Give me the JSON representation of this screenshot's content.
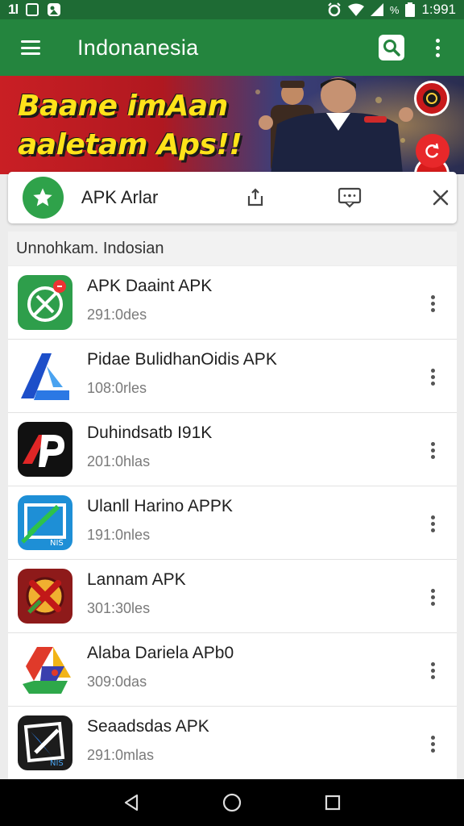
{
  "status_bar": {
    "left_items": [
      "1l"
    ],
    "time": "1:991",
    "battery_text": "%"
  },
  "app_bar": {
    "title": "Indonanesia"
  },
  "banner": {
    "line1": "Baane imAan",
    "line2": "aaletam Aps!!"
  },
  "download_card": {
    "label": "APK Arlar"
  },
  "section_header": {
    "title": "Unnohkam. Indosian"
  },
  "apps": [
    {
      "name": "APK Daaint APK",
      "size": "291:0des",
      "icon": "green-compass-icon"
    },
    {
      "name": "Pidae BulidhanOidis APK",
      "size": "108:0rles",
      "icon": "blue-arrow-icon"
    },
    {
      "name": "Duhindsatb I91K",
      "size": "201:0hlas",
      "icon": "black-ap-icon"
    },
    {
      "name": "Ulanll Harino APPK",
      "size": "191:0nles",
      "icon": "blue-check-icon"
    },
    {
      "name": "Lannam APK",
      "size": "301:30les",
      "icon": "red-cross-icon"
    },
    {
      "name": "Alaba Dariela APb0",
      "size": "309:0das",
      "icon": "drive-triangle-icon"
    },
    {
      "name": "Seaadsdas APK",
      "size": "291:0mlas",
      "icon": "dark-bolt-icon"
    }
  ],
  "colors": {
    "status_bar": "#1e6b34",
    "app_bar": "#24853e",
    "star_badge": "#2fa24a",
    "banner_text": "#ffe31a"
  }
}
